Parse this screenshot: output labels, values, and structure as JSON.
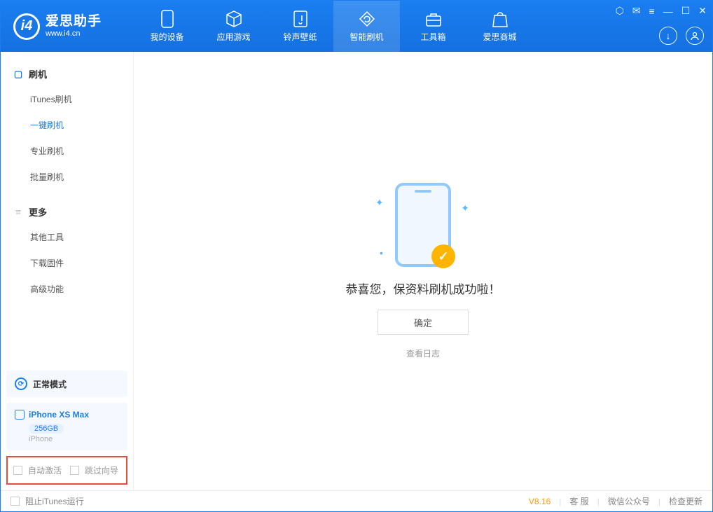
{
  "app": {
    "name_cn": "爱思助手",
    "name_en": "www.i4.cn"
  },
  "tabs": [
    {
      "label": "我的设备",
      "icon": "device-icon"
    },
    {
      "label": "应用游戏",
      "icon": "cube-icon"
    },
    {
      "label": "铃声壁纸",
      "icon": "music-icon"
    },
    {
      "label": "智能刷机",
      "icon": "refresh-icon",
      "active": true
    },
    {
      "label": "工具箱",
      "icon": "toolbox-icon"
    },
    {
      "label": "爱思商城",
      "icon": "bag-icon"
    }
  ],
  "sidebar": {
    "section1": {
      "title": "刷机",
      "items": [
        {
          "label": "iTunes刷机"
        },
        {
          "label": "一键刷机",
          "active": true
        },
        {
          "label": "专业刷机"
        },
        {
          "label": "批量刷机"
        }
      ]
    },
    "section2": {
      "title": "更多",
      "items": [
        {
          "label": "其他工具"
        },
        {
          "label": "下载固件"
        },
        {
          "label": "高级功能"
        }
      ]
    },
    "mode": "正常模式",
    "device": {
      "name": "iPhone XS Max",
      "storage": "256GB",
      "type": "iPhone"
    },
    "options": {
      "auto_activate": "自动激活",
      "skip_guide": "跳过向导"
    }
  },
  "main": {
    "success": "恭喜您，保资料刷机成功啦！",
    "ok": "确定",
    "log": "查看日志"
  },
  "statusbar": {
    "block_itunes": "阻止iTunes运行",
    "version": "V8.16",
    "service": "客 服",
    "wechat": "微信公众号",
    "update": "检查更新"
  }
}
